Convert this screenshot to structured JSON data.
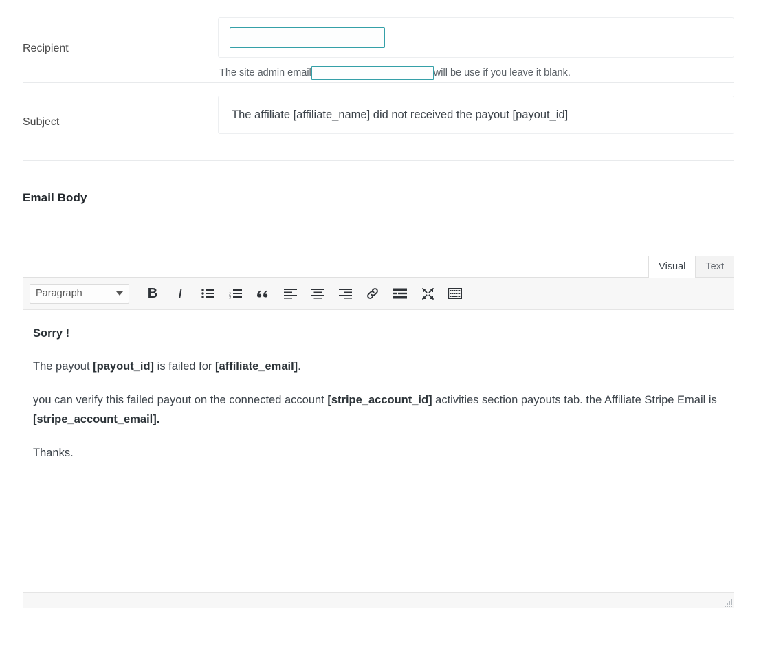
{
  "theme": {
    "accent": "#35a0a8",
    "text": "#3c434a",
    "heading": "#23282d",
    "divider": "#e8eaec",
    "toolbar_bg": "#f7f7f7",
    "tab_inactive_bg": "#f3f3f3"
  },
  "recipient": {
    "label": "Recipient",
    "value": "",
    "placeholder": "",
    "help_before": "The site admin email",
    "help_inline_value": "",
    "help_inline_placeholder": "",
    "help_after": "will be use if you leave it blank."
  },
  "subject": {
    "label": "Subject",
    "value": "The affiliate [affiliate_name] did not received the payout [payout_id]",
    "placeholder": ""
  },
  "email_body": {
    "section_title": "Email Body",
    "tabs": [
      {
        "label": "Visual",
        "active": true
      },
      {
        "label": "Text",
        "active": false
      }
    ],
    "toolbar": {
      "format_select_value": "Paragraph",
      "format_options": [
        "Paragraph"
      ],
      "buttons": [
        {
          "name": "bold-icon",
          "label": "B",
          "title": "Bold"
        },
        {
          "name": "italic-icon",
          "label": "I",
          "title": "Italic"
        },
        {
          "name": "bulleted-list-icon",
          "label": "",
          "title": "Bulleted list"
        },
        {
          "name": "numbered-list-icon",
          "label": "",
          "title": "Numbered list"
        },
        {
          "name": "blockquote-icon",
          "label": "“",
          "title": "Blockquote"
        },
        {
          "name": "align-left-icon",
          "label": "",
          "title": "Align left"
        },
        {
          "name": "align-center-icon",
          "label": "",
          "title": "Align center"
        },
        {
          "name": "align-right-icon",
          "label": "",
          "title": "Align right"
        },
        {
          "name": "link-icon",
          "label": "",
          "title": "Insert/edit link"
        },
        {
          "name": "read-more-icon",
          "label": "",
          "title": "Insert Read More tag"
        },
        {
          "name": "fullscreen-icon",
          "label": "",
          "title": "Distraction-free writing mode"
        },
        {
          "name": "toolbar-toggle-icon",
          "label": "",
          "title": "Toolbar Toggle"
        }
      ]
    },
    "content": {
      "p1_strong": "Sorry !",
      "p2": [
        {
          "t": "The payout ",
          "b": false
        },
        {
          "t": "[payout_id]",
          "b": true
        },
        {
          "t": " is failed for ",
          "b": false
        },
        {
          "t": "[affiliate_email]",
          "b": true
        },
        {
          "t": ".",
          "b": false
        }
      ],
      "p3": [
        {
          "t": "you can verify this failed payout on the connected account ",
          "b": false
        },
        {
          "t": "[stripe_account_id]",
          "b": true
        },
        {
          "t": " activities section payouts tab.  the Affiliate Stripe Email is ",
          "b": false
        },
        {
          "t": "[stripe_account_email].",
          "b": true
        }
      ],
      "p4": "Thanks."
    }
  }
}
